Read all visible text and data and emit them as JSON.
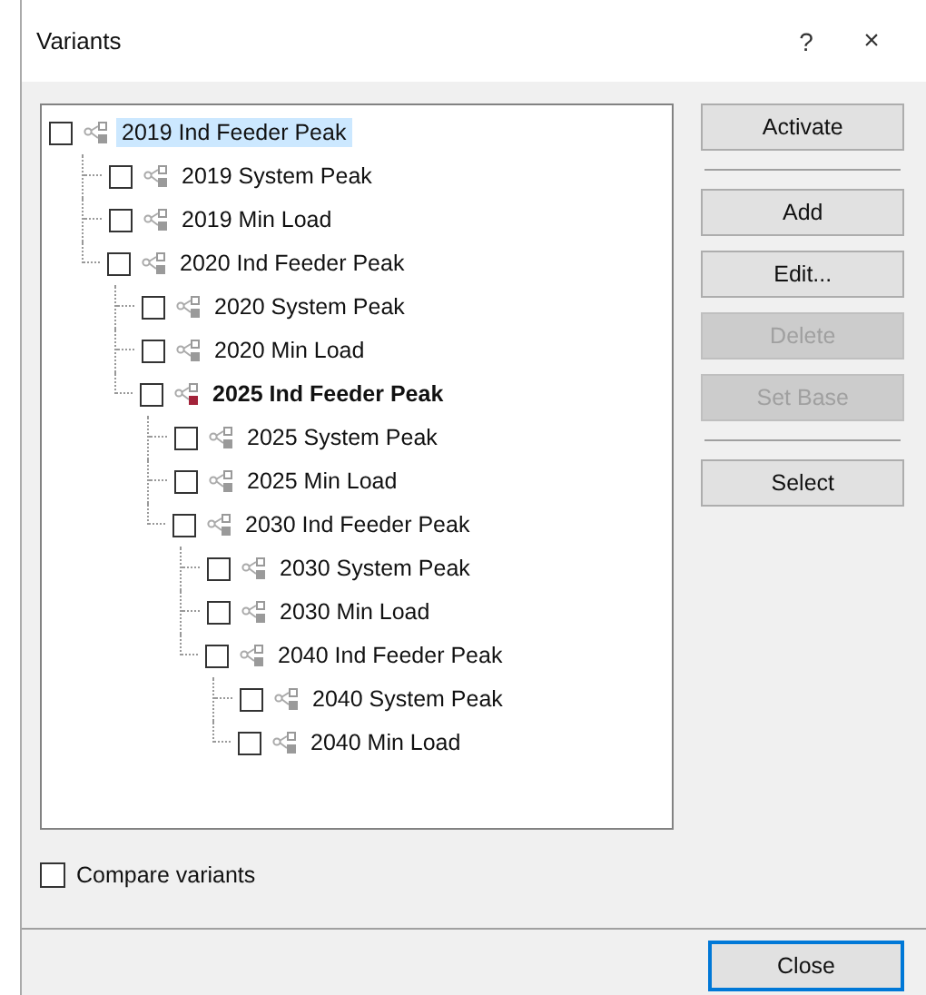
{
  "window": {
    "title": "Variants",
    "help": "?",
    "close": "×"
  },
  "tree": [
    {
      "label": "2019 Ind Feeder Peak",
      "checked": false,
      "selected": true,
      "active": false,
      "children": [
        {
          "label": "2019 System Peak",
          "checked": false,
          "selected": false,
          "active": false
        },
        {
          "label": "2019 Min Load",
          "checked": false,
          "selected": false,
          "active": false
        },
        {
          "label": "2020 Ind Feeder Peak",
          "checked": false,
          "selected": false,
          "active": false,
          "children": [
            {
              "label": "2020 System Peak",
              "checked": false,
              "selected": false,
              "active": false
            },
            {
              "label": "2020 Min Load",
              "checked": false,
              "selected": false,
              "active": false
            },
            {
              "label": "2025 Ind Feeder Peak",
              "checked": false,
              "selected": false,
              "active": true,
              "children": [
                {
                  "label": "2025 System Peak",
                  "checked": false,
                  "selected": false,
                  "active": false
                },
                {
                  "label": "2025 Min Load",
                  "checked": false,
                  "selected": false,
                  "active": false
                },
                {
                  "label": "2030 Ind Feeder Peak",
                  "checked": false,
                  "selected": false,
                  "active": false,
                  "children": [
                    {
                      "label": "2030 System Peak",
                      "checked": false,
                      "selected": false,
                      "active": false
                    },
                    {
                      "label": "2030 Min Load",
                      "checked": false,
                      "selected": false,
                      "active": false
                    },
                    {
                      "label": "2040 Ind Feeder Peak",
                      "checked": false,
                      "selected": false,
                      "active": false,
                      "children": [
                        {
                          "label": "2040 System Peak",
                          "checked": false,
                          "selected": false,
                          "active": false
                        },
                        {
                          "label": "2040 Min Load",
                          "checked": false,
                          "selected": false,
                          "active": false
                        }
                      ]
                    }
                  ]
                }
              ]
            }
          ]
        }
      ]
    }
  ],
  "buttons": [
    {
      "label": "Activate",
      "disabled": false,
      "separator_after": true
    },
    {
      "label": "Add",
      "disabled": false,
      "separator_after": false
    },
    {
      "label": "Edit...",
      "disabled": false,
      "separator_after": false
    },
    {
      "label": "Delete",
      "disabled": true,
      "separator_after": false
    },
    {
      "label": "Set Base",
      "disabled": true,
      "separator_after": true
    },
    {
      "label": "Select",
      "disabled": false,
      "separator_after": false
    }
  ],
  "compare": {
    "label": "Compare variants",
    "checked": false
  },
  "footer_buttons": [
    {
      "label": "Close",
      "focused": true
    }
  ]
}
